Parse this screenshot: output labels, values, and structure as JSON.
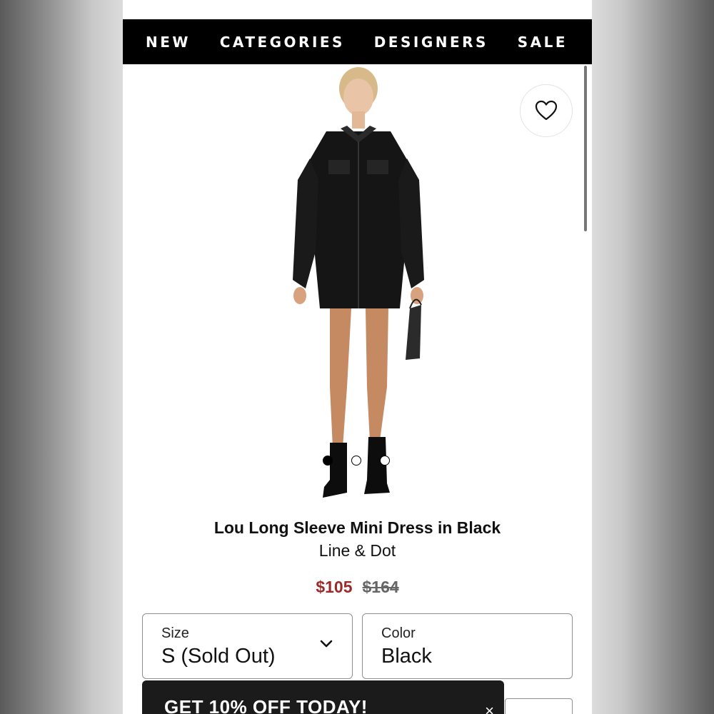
{
  "nav": {
    "items": [
      {
        "label": "NEW"
      },
      {
        "label": "CATEGORIES"
      },
      {
        "label": "DESIGNERS"
      },
      {
        "label": "SALE"
      }
    ]
  },
  "product": {
    "title": "Lou Long Sleeve Mini Dress in Black",
    "brand": "Line & Dot",
    "sale_price": "$105",
    "original_price": "$164",
    "image_carousel": {
      "total": 3,
      "active_index": 0
    }
  },
  "size_select": {
    "label": "Size",
    "value": "S (Sold Out)"
  },
  "color_select": {
    "label": "Color",
    "value": "Black"
  },
  "promo": {
    "text": "GET 10% OFF TODAY!",
    "close": "×"
  },
  "icons": {
    "wishlist": "heart-icon",
    "dropdown": "chevron-down-icon"
  },
  "colors": {
    "nav_bg": "#000000",
    "sale_price": "#9b2a2a",
    "promo_bg": "#1b1b1b"
  }
}
